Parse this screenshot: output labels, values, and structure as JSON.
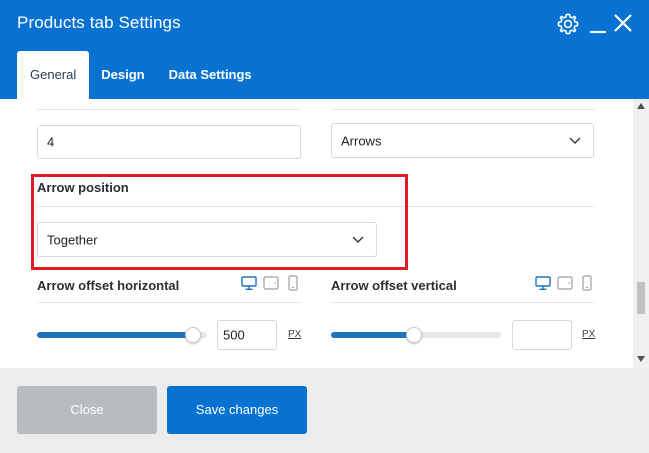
{
  "window": {
    "title": "Products tab Settings"
  },
  "header_icons": [
    "gear-icon",
    "minimize-icon",
    "close-icon"
  ],
  "tabs": [
    {
      "label": "General",
      "active": true
    },
    {
      "label": "Design",
      "active": false
    },
    {
      "label": "Data Settings",
      "active": false
    }
  ],
  "fields": {
    "number_value": "4",
    "navigation_select": "Arrows",
    "arrow_position": {
      "label": "Arrow position",
      "value": "Together"
    },
    "offset_horizontal": {
      "label": "Arrow offset horizontal",
      "value": "500",
      "unit": "PX",
      "slider_fraction": 0.92
    },
    "offset_vertical": {
      "label": "Arrow offset vertical",
      "value": "",
      "unit": "PX",
      "slider_fraction": 0.49
    }
  },
  "footer": {
    "close_label": "Close",
    "save_label": "Save changes"
  },
  "colors": {
    "brand": "#0872d3",
    "highlight": "#e01b24",
    "slider": "#1e73be"
  }
}
